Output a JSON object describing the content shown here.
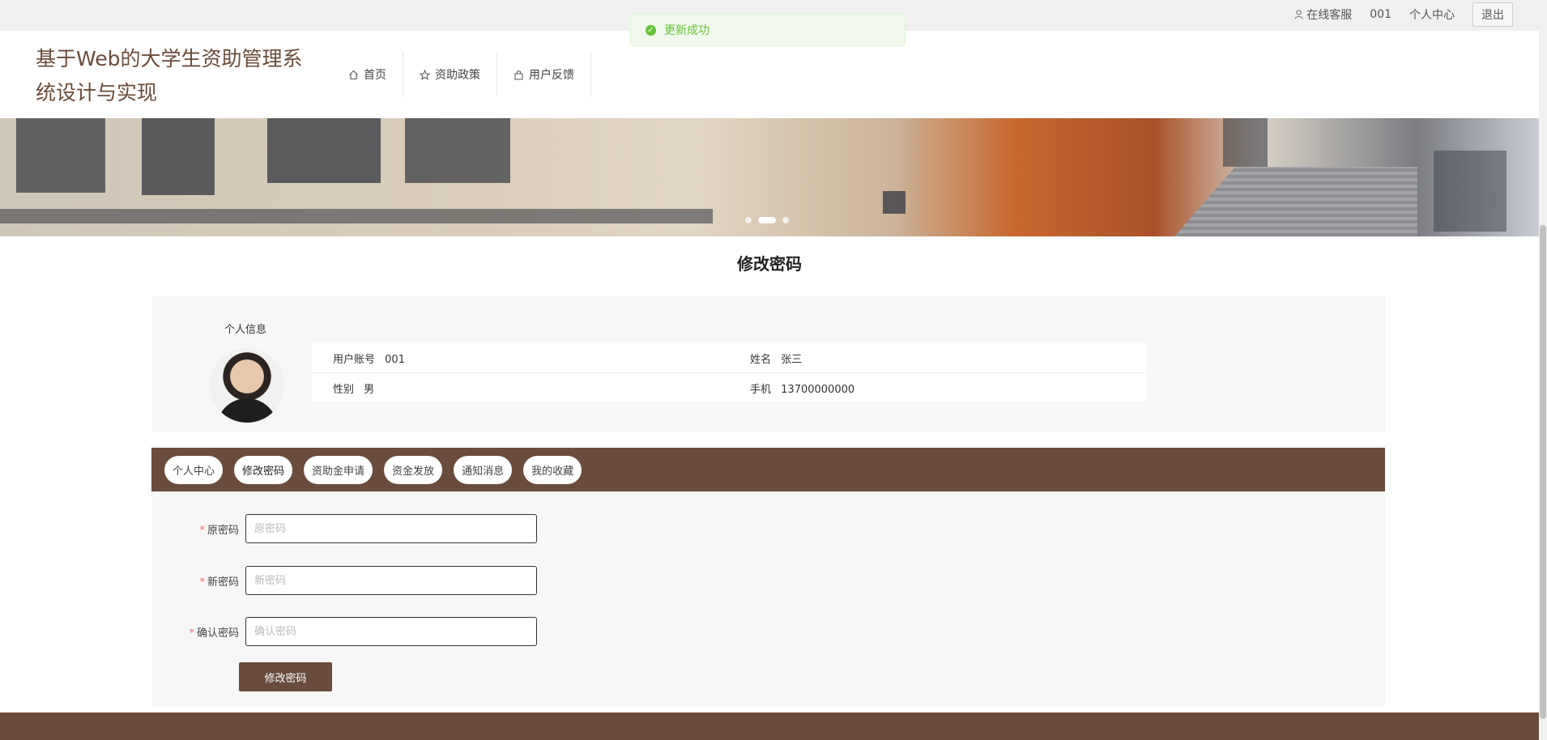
{
  "topbar": {
    "service_label": "在线客服",
    "username": "001",
    "profile_label": "个人中心",
    "logout_label": "退出"
  },
  "toast": {
    "message": "更新成功",
    "color": "#67c23a"
  },
  "header": {
    "site_title": "基于Web的大学生资助管理系统设计与实现",
    "nav": [
      {
        "label": "首页",
        "icon": "home-icon"
      },
      {
        "label": "资助政策",
        "icon": "star-icon"
      },
      {
        "label": "用户反馈",
        "icon": "bag-icon"
      }
    ]
  },
  "banner": {
    "slides": 3,
    "active_slide": 2
  },
  "page": {
    "title": "修改密码"
  },
  "profile": {
    "section_label": "个人信息",
    "fields": [
      {
        "key": "用户账号",
        "value": "001"
      },
      {
        "key": "姓名",
        "value": "张三"
      },
      {
        "key": "性别",
        "value": "男"
      },
      {
        "key": "手机",
        "value": "13700000000"
      }
    ]
  },
  "tabs": [
    {
      "label": "个人中心"
    },
    {
      "label": "修改密码"
    },
    {
      "label": "资助金申请"
    },
    {
      "label": "资金发放"
    },
    {
      "label": "通知消息"
    },
    {
      "label": "我的收藏"
    }
  ],
  "form": {
    "old_password": {
      "label": "原密码",
      "placeholder": "原密码"
    },
    "new_password": {
      "label": "新密码",
      "placeholder": "新密码"
    },
    "confirm_password": {
      "label": "确认密码",
      "placeholder": "确认密码"
    },
    "submit_label": "修改密码"
  },
  "colors": {
    "brand": "#6a4c3c",
    "title": "#6a4c3a"
  }
}
